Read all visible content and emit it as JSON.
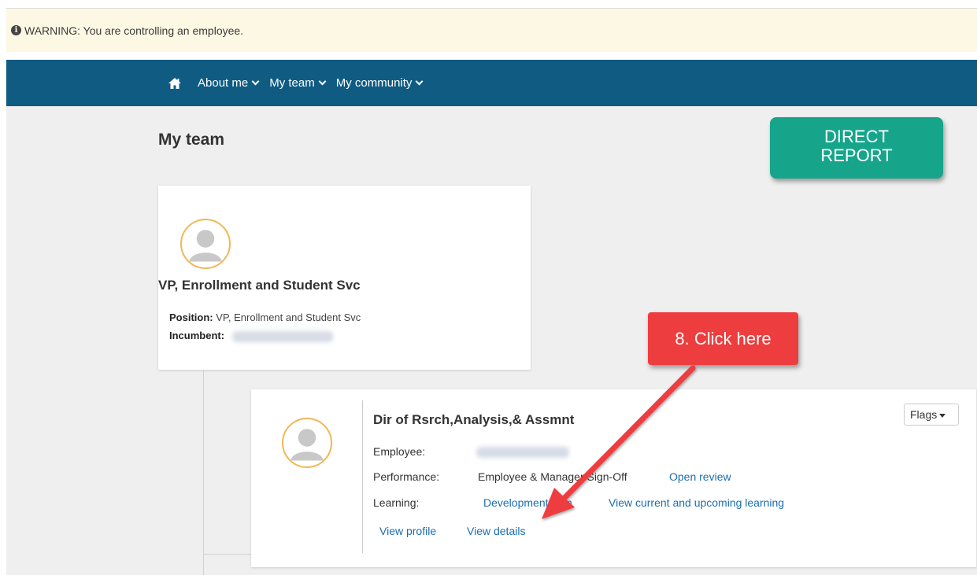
{
  "warning": {
    "text": "WARNING: You are controlling an employee.",
    "icon": "info-icon"
  },
  "nav": {
    "home_icon": "home-icon",
    "items": [
      {
        "label": "About me"
      },
      {
        "label": "My team"
      },
      {
        "label": "My community"
      }
    ],
    "bg_color": "#0f5b82"
  },
  "page": {
    "title": "My team"
  },
  "annotations": {
    "direct_report": [
      "DIRECT",
      "REPORT"
    ],
    "callout": "8. Click here",
    "direct_report_color": "#16a58a",
    "callout_color": "#ee3d3f"
  },
  "manager_card": {
    "title": "VP, Enrollment and Student Svc",
    "position_label": "Position:",
    "position_value": "VP, Enrollment and Student Svc",
    "incumbent_label": "Incumbent:"
  },
  "report_card": {
    "title": "Dir of Rsrch,Analysis,& Assmnt",
    "flags_label": "Flags",
    "employee_label": "Employee:",
    "performance_label": "Performance:",
    "performance_status": "Employee & Manager Sign-Off",
    "open_review": "Open review",
    "learning_label": "Learning:",
    "development_plan": "Development plan",
    "view_learning": "View current and upcoming learning",
    "view_profile": "View profile",
    "view_details": "View details"
  }
}
